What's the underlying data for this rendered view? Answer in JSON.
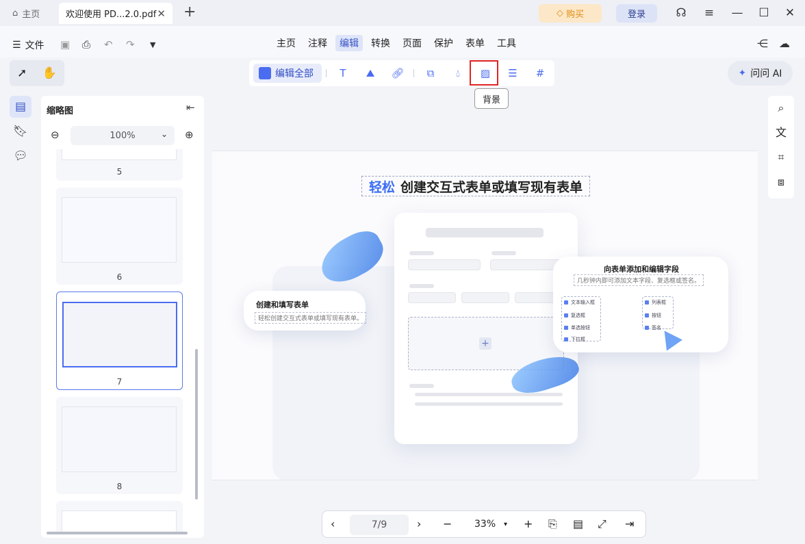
{
  "titlebar": {
    "home_tab": "主页",
    "doc_tab": "欢迎使用 PD...2.0.pdf",
    "close": "✕",
    "new_tab": "+",
    "buy": "购买",
    "login": "登录"
  },
  "menubar": {
    "file": "文件",
    "items": [
      "主页",
      "注释",
      "编辑",
      "转换",
      "页面",
      "保护",
      "表单",
      "工具"
    ],
    "active": "编辑"
  },
  "toolbar": {
    "edit_all": "编辑全部",
    "tooltip": "背景",
    "ai": "问问 AI"
  },
  "thumbnails": {
    "title": "缩略图",
    "zoom": "100%",
    "pages": [
      "5",
      "6",
      "7",
      "8"
    ]
  },
  "document": {
    "headline_highlight": "轻松",
    "headline_rest": "创建交互式表单或填写现有表单",
    "left_callout_title": "创建和填写表单",
    "left_callout_sub": "轻松创建交互式表单或填写现有表单。",
    "right_callout_title": "向表单添加和编辑字段",
    "right_callout_sub": "几秒钟内即可添加文本字段、复选框或签名。",
    "fields_left": [
      "文本输入框",
      "复选框",
      "单选按钮",
      "下拉框"
    ],
    "fields_right": [
      "列表框",
      "按钮",
      "签名"
    ]
  },
  "bottom": {
    "page": "7/9",
    "zoom": "33%"
  }
}
